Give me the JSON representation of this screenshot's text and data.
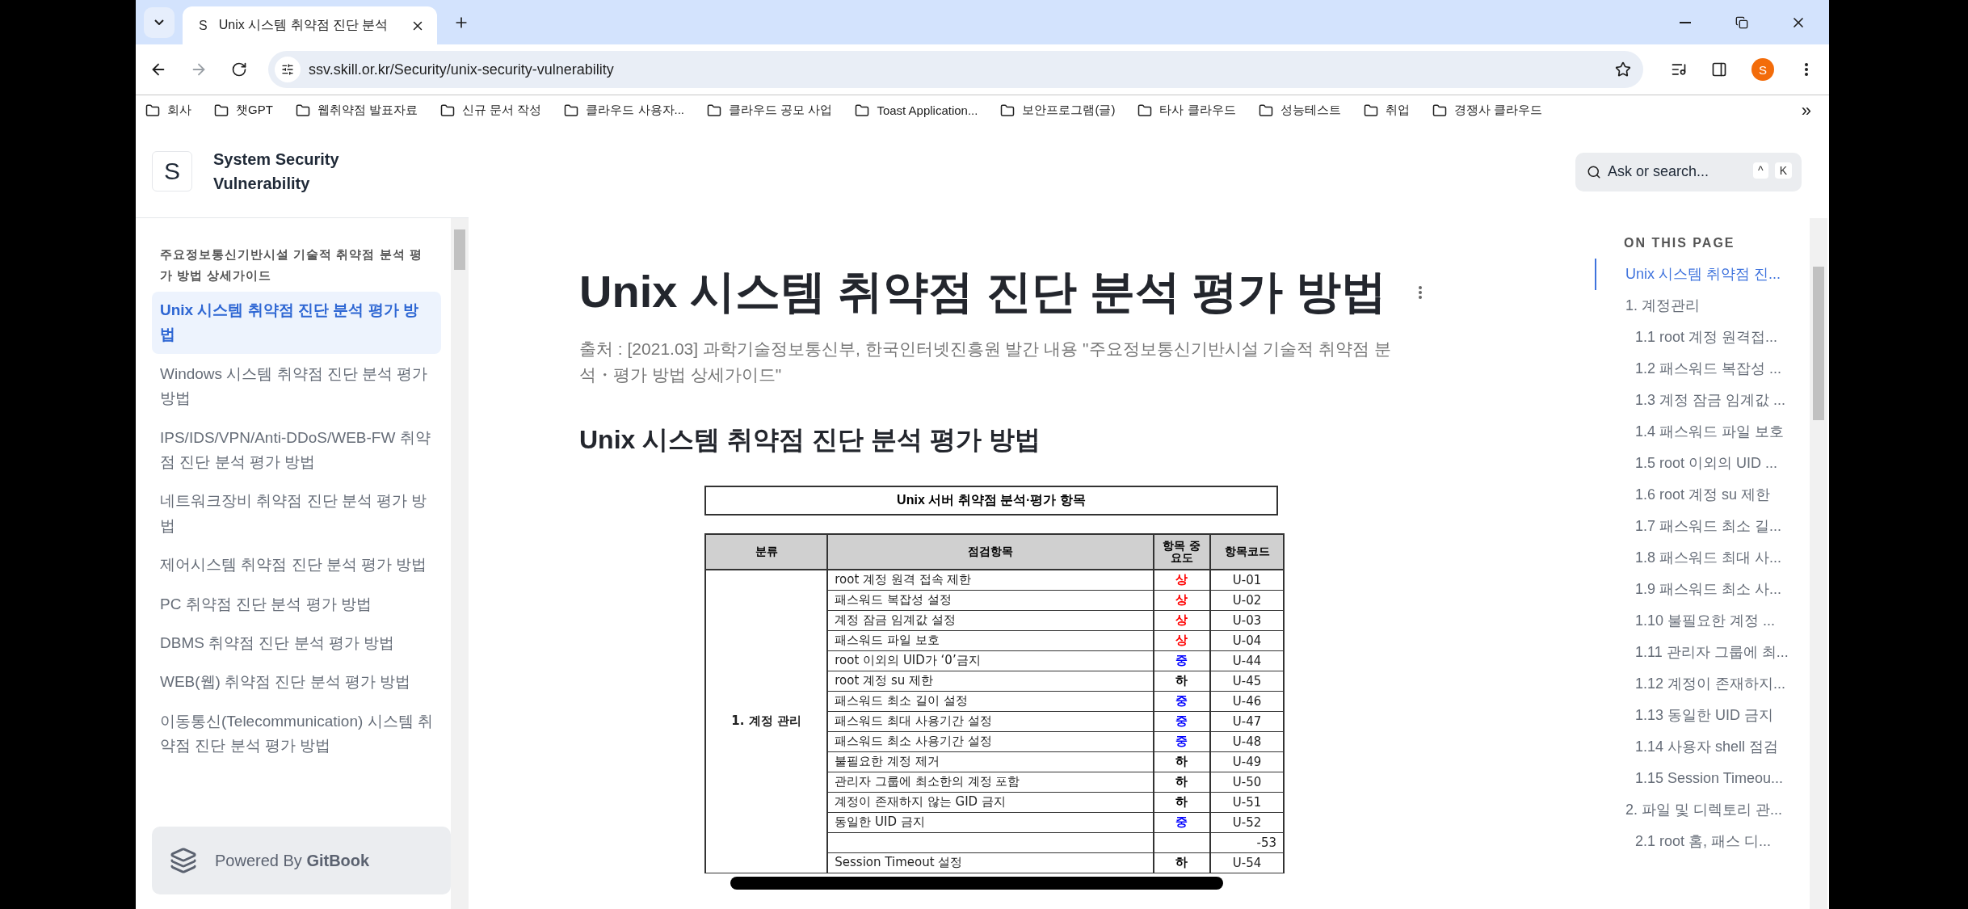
{
  "browser": {
    "tab": {
      "favicon": "S",
      "title": "Unix 시스템 취약점 진단 분석"
    },
    "url": "ssv.skill.or.kr/Security/unix-security-vulnerability",
    "profile": "S",
    "bookmarks": [
      "회사",
      "챗GPT",
      "웹취약점 발표자료",
      "신규 문서 작성",
      "클라우드 사용자...",
      "클라우드 공모 사업",
      "Toast Application...",
      "보안프로그램(글)",
      "타사 클라우드",
      "성능테스트",
      "취업",
      "경쟁사 클라우드"
    ],
    "more": "»"
  },
  "site": {
    "logo": "S",
    "title": "System Security Vulnerability"
  },
  "search": {
    "placeholder": "Ask or search...",
    "shortcut": [
      "^",
      "K"
    ]
  },
  "sidebar": {
    "group": "주요정보통신기반시설 기술적 취약점 분석 평가 방법 상세가이드",
    "items": [
      {
        "label": "Unix 시스템 취약점 진단 분석 평가 방법",
        "selected": true
      },
      {
        "label": "Windows 시스템 취약점 진단 분석 평가 방법",
        "selected": false
      },
      {
        "label": "IPS/IDS/VPN/Anti-DDoS/WEB-FW 취약점 진단 분석 평가 방법",
        "selected": false
      },
      {
        "label": "네트워크장비 취약점 진단 분석 평가 방법",
        "selected": false
      },
      {
        "label": "제어시스템 취약점 진단 분석 평가 방법",
        "selected": false
      },
      {
        "label": "PC 취약점 진단 분석 평가 방법",
        "selected": false
      },
      {
        "label": "DBMS 취약점 진단 분석 평가 방법",
        "selected": false
      },
      {
        "label": "WEB(웹) 취약점 진단 분석 평가 방법",
        "selected": false
      },
      {
        "label": "이동통신(Telecommunication) 시스템 취약점 진단 분석 평가 방법",
        "selected": false
      }
    ],
    "powered": "Powered By **GitBook**"
  },
  "article": {
    "title": "Unix 시스템 취약점 진단 분석 평가 방법",
    "source": "출처 : [2021.03] 과학기술정보통신부, 한국인터넷진흥원 발간 내용 \"주요정보통신기반시설 기술적 취약점 분석・평가 방법 상세가이드\"",
    "heading": "Unix 시스템 취약점 진단 분석 평가 방법",
    "table": {
      "caption": "Unix 서버 취약점 분석·평가 항목",
      "columns": [
        "분류",
        "점검항목",
        "항목 중요도",
        "항목코드"
      ],
      "category": "1. 계정 관리",
      "rows": [
        {
          "item": "root 계정 원격 접속 제한",
          "importance": "상",
          "color": "#ff0000",
          "code": "U-01"
        },
        {
          "item": "패스워드 복잡성 설정",
          "importance": "상",
          "color": "#ff0000",
          "code": "U-02"
        },
        {
          "item": "계정 잠금 임계값 설정",
          "importance": "상",
          "color": "#ff0000",
          "code": "U-03"
        },
        {
          "item": "패스워드 파일 보호",
          "importance": "상",
          "color": "#ff0000",
          "code": "U-04"
        },
        {
          "item": "root 이외의 UID가 ‘0’금지",
          "importance": "중",
          "color": "#0000ff",
          "code": "U-44"
        },
        {
          "item": "root 계정 su 제한",
          "importance": "하",
          "color": "#000000",
          "code": "U-45"
        },
        {
          "item": "패스워드 최소 길이 설정",
          "importance": "중",
          "color": "#0000ff",
          "code": "U-46"
        },
        {
          "item": "패스워드 최대 사용기간 설정",
          "importance": "중",
          "color": "#0000ff",
          "code": "U-47"
        },
        {
          "item": "패스워드 최소 사용기간 설정",
          "importance": "중",
          "color": "#0000ff",
          "code": "U-48"
        },
        {
          "item": "불필요한 계정 제거",
          "importance": "하",
          "color": "#000000",
          "code": "U-49"
        },
        {
          "item": "관리자 그룹에 최소한의 계정 포함",
          "importance": "하",
          "color": "#000000",
          "code": "U-50"
        },
        {
          "item": "계정이 존재하지 않는 GID 금지",
          "importance": "하",
          "color": "#000000",
          "code": "U-51"
        },
        {
          "item": "동일한 UID 금지",
          "importance": "중",
          "color": "#0000ff",
          "code": "U-52"
        },
        {
          "code": "-53"
        },
        {
          "item": "Session Timeout 설정",
          "importance": "하",
          "color": "#000000",
          "code": "U-54"
        }
      ]
    }
  },
  "toc": {
    "heading": "ON THIS PAGE",
    "items": [
      {
        "label": "Unix 시스템 취약점 진...",
        "selected": true
      },
      {
        "label": "1. 계정관리",
        "selected": false,
        "children": [
          {
            "label": "1.1 root 계정 원격접...",
            "selected": false
          },
          {
            "label": "1.2 패스워드 복잡성 ...",
            "selected": false
          },
          {
            "label": "1.3 계정 잠금 임계값 ...",
            "selected": false
          },
          {
            "label": "1.4 패스워드 파일 보호",
            "selected": false
          },
          {
            "label": "1.5 root 이외의 UID ...",
            "selected": false
          },
          {
            "label": "1.6 root 계정 su 제한",
            "selected": false
          },
          {
            "label": "1.7 패스워드 최소 길...",
            "selected": false
          },
          {
            "label": "1.8 패스워드 최대 사...",
            "selected": false
          },
          {
            "label": "1.9 패스워드 최소 사...",
            "selected": false
          },
          {
            "label": "1.10 불필요한 계정 ...",
            "selected": false
          },
          {
            "label": "1.11 관리자 그룹에 최...",
            "selected": false
          },
          {
            "label": "1.12 계정이 존재하지...",
            "selected": false
          },
          {
            "label": "1.13 동일한 UID 금지",
            "selected": false
          },
          {
            "label": "1.14 사용자 shell 점검",
            "selected": false
          },
          {
            "label": "1.15 Session Timeou...",
            "selected": false
          }
        ]
      },
      {
        "label": "2. 파일 및 디렉토리 관...",
        "selected": false,
        "children": [
          {
            "label": "2.1 root 홈, 패스 디...",
            "selected": false
          }
        ]
      }
    ]
  }
}
